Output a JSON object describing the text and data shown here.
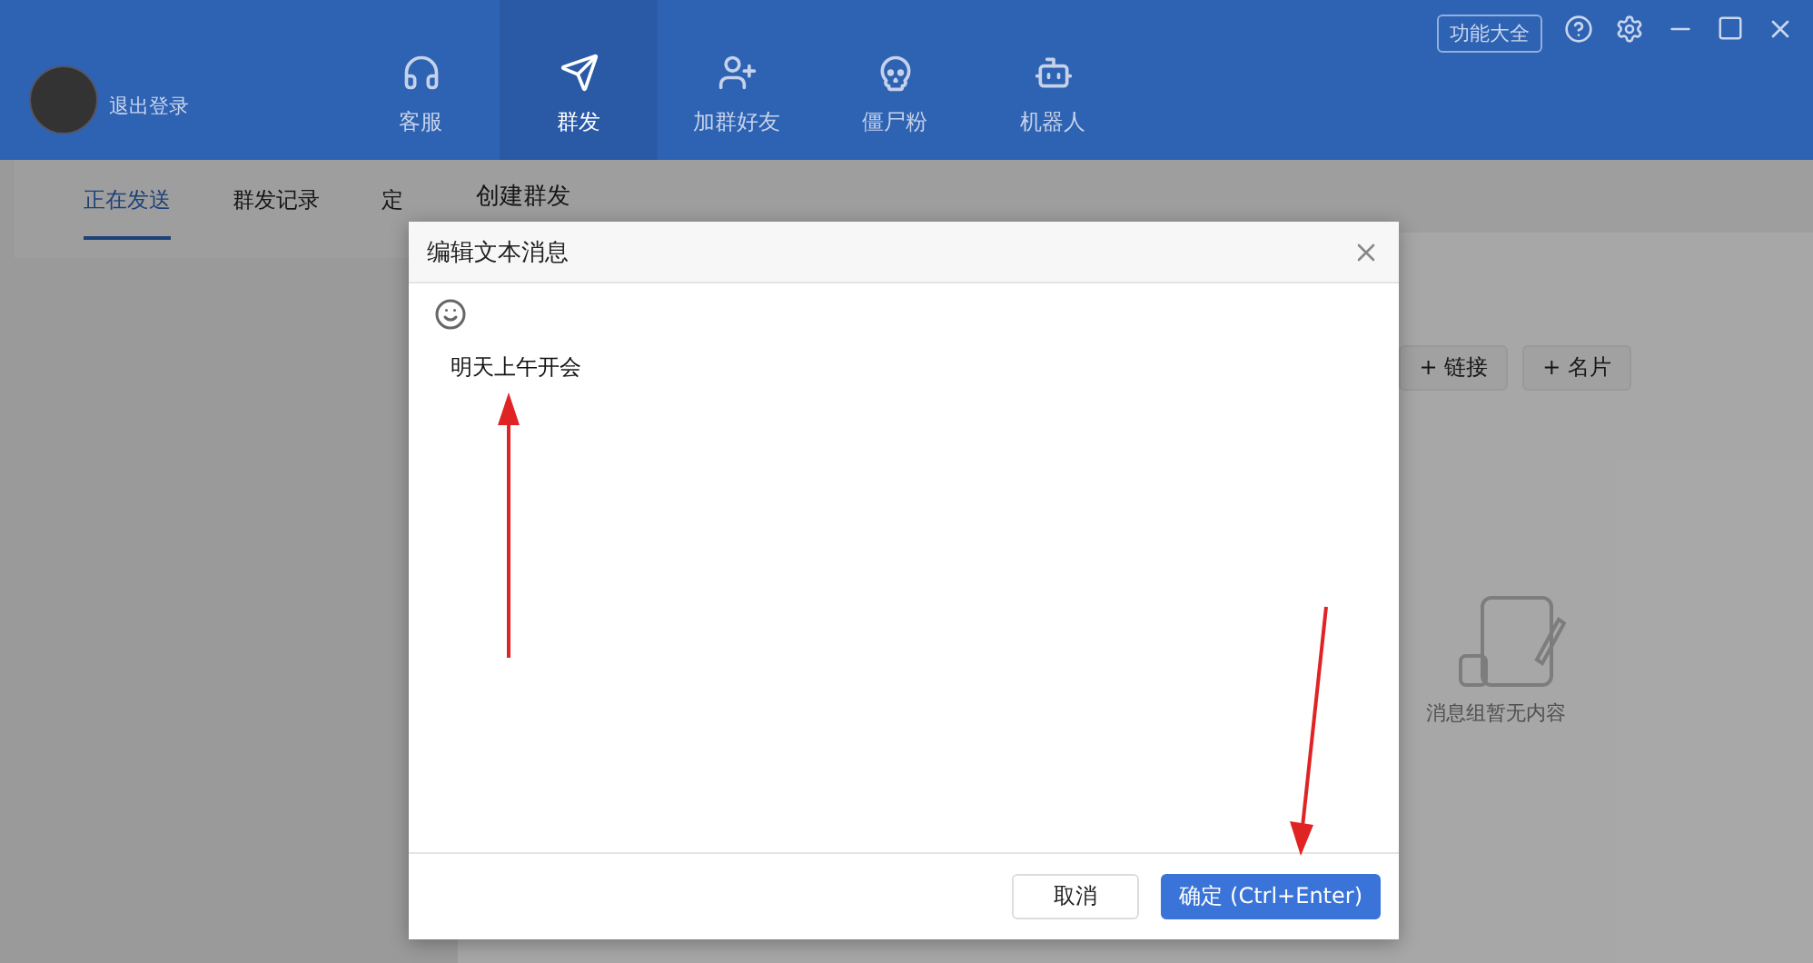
{
  "header": {
    "logout": "退出登录",
    "nav": [
      {
        "label": "客服",
        "selected": false
      },
      {
        "label": "群发",
        "selected": true
      },
      {
        "label": "加群好友",
        "selected": false
      },
      {
        "label": "僵尸粉",
        "selected": false
      },
      {
        "label": "机器人",
        "selected": false
      }
    ],
    "features_button": "功能大全"
  },
  "left_panel": {
    "tabs": [
      {
        "label": "正在发送",
        "selected": true
      },
      {
        "label": "群发记录",
        "selected": false
      },
      {
        "label": "定",
        "selected": false
      }
    ]
  },
  "right_panel": {
    "title": "创建群发",
    "add_buttons": [
      "+ 链接",
      "+ 名片"
    ],
    "empty_text": "消息组暂无内容"
  },
  "dialog": {
    "title": "编辑文本消息",
    "message": "明天上午开会",
    "buttons": [
      {
        "label": "取消",
        "kind": "secondary"
      },
      {
        "label": "确定 (Ctrl+Enter)",
        "kind": "primary"
      }
    ]
  }
}
